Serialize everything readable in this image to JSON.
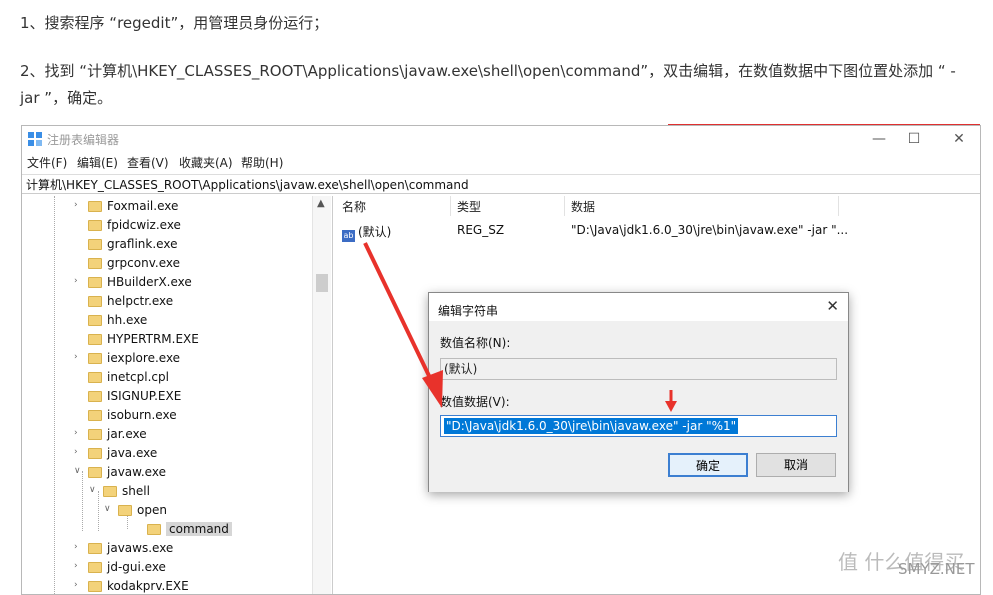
{
  "article": {
    "step1": "1、搜索程序 “regedit”，用管理员身份运行；",
    "step2": "2、找到 “计算机\\HKEY_CLASSES_ROOT\\Applications\\javaw.exe\\shell\\open\\command”，双击编辑，在数值数据中下图位置处添加 “ -jar ”，确定。"
  },
  "window": {
    "title": "注册表编辑器",
    "controls": {
      "minimize": "—",
      "maximize": "☐",
      "close": "✕"
    },
    "menu": [
      "文件(F)",
      "编辑(E)",
      "查看(V)",
      "收藏夹(A)",
      "帮助(H)"
    ],
    "address": "计算机\\HKEY_CLASSES_ROOT\\Applications\\javaw.exe\\shell\\open\\command"
  },
  "tree": [
    "Foxmail.exe",
    "fpidcwiz.exe",
    "graflink.exe",
    "grpconv.exe",
    "HBuilderX.exe",
    "helpctr.exe",
    "hh.exe",
    "HYPERTRM.EXE",
    "iexplore.exe",
    "inetcpl.cpl",
    "ISIGNUP.EXE",
    "isoburn.exe",
    "jar.exe",
    "java.exe",
    "javaw.exe",
    "shell",
    "open",
    "command",
    "javaws.exe",
    "jd-gui.exe",
    "kodakprv.EXE"
  ],
  "list": {
    "headers": {
      "name": "名称",
      "type": "类型",
      "data": "数据"
    },
    "row": {
      "icon": "ab",
      "name": "(默认)",
      "type": "REG_SZ",
      "data": "\"D:\\Java\\jdk1.6.0_30\\jre\\bin\\javaw.exe\" -jar \"..."
    }
  },
  "dialog": {
    "title": "编辑字符串",
    "close": "✕",
    "name_label": "数值名称(N):",
    "name_value": "(默认)",
    "data_label": "数值数据(V):",
    "data_value": "\"D:\\Java\\jdk1.6.0_30\\jre\\bin\\javaw.exe\" -jar \"%1\"",
    "ok": "确定",
    "cancel": "取消"
  },
  "watermark": {
    "text": "值 什么值得买",
    "site": "SMYZ.NET"
  },
  "colors": {
    "accent": "#0078d7",
    "arrow": "#e8322b"
  }
}
